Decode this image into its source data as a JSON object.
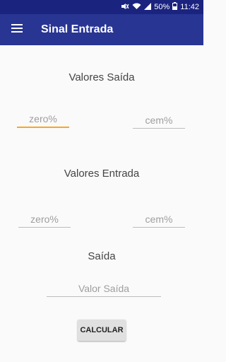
{
  "status_bar": {
    "battery_text": "50%",
    "time": "11:42",
    "icons": [
      "mute-icon",
      "wifi-icon",
      "signal-icon",
      "battery-icon"
    ]
  },
  "app_bar": {
    "title": "Sinal Entrada",
    "menu_icon": "menu-icon"
  },
  "output_values": {
    "label": "Valores Saída",
    "zero_placeholder": "zero%",
    "hundred_placeholder": "cem%"
  },
  "input_values": {
    "label": "Valores Entrada",
    "zero_placeholder": "zero%",
    "hundred_placeholder": "cem%"
  },
  "result": {
    "label": "Saída",
    "placeholder": "Valor Saída"
  },
  "calculate_button": "CALCULAR",
  "colors": {
    "status_bar": "#1a237e",
    "app_bar": "#283593",
    "focus_accent": "#f9a825"
  }
}
